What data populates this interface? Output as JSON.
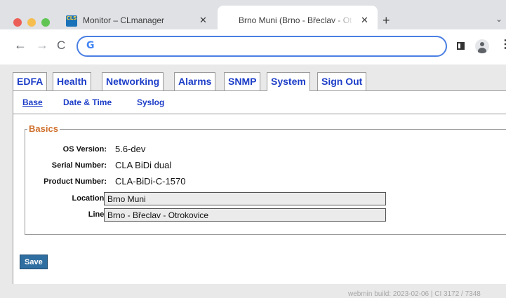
{
  "browser": {
    "tabs": [
      {
        "title": "Monitor – CLmanager",
        "favicon": "CLS"
      },
      {
        "title": "Brno Muni (Brno - Břeclav - Ot"
      }
    ],
    "close_glyph": "✕",
    "new_tab": "+",
    "tabs_menu": "⌄",
    "back": "←",
    "forward": "→",
    "reload": "C",
    "omnibox_icon": "G",
    "kebab": "⋮"
  },
  "nav": {
    "tabs": [
      "EDFA",
      "Health",
      "Networking",
      "Alarms",
      "SNMP",
      "System",
      "Sign Out"
    ],
    "active": "System"
  },
  "subnav": {
    "items": [
      "Base",
      "Date & Time",
      "Syslog"
    ],
    "active": "Base"
  },
  "basics": {
    "legend": "Basics",
    "os_version_label": "OS Version:",
    "os_version": "5.6-dev",
    "serial_label": "Serial Number:",
    "serial": "CLA BiDi dual",
    "product_label": "Product Number:",
    "product": "CLA-BiDi-C-1570",
    "location_label": "Location:",
    "location": "Brno Muni",
    "line_label": "Line:",
    "line": "Brno - Břeclav - Otrokovice"
  },
  "save_label": "Save",
  "footer": "webmin build: 2023-02-06 | CI 3172 / 7348",
  "colors": {
    "link": "#1d3ec8",
    "legend": "#d0702c",
    "save_bg": "#2f6ea0",
    "omnibox_border": "#4a7fe3"
  }
}
